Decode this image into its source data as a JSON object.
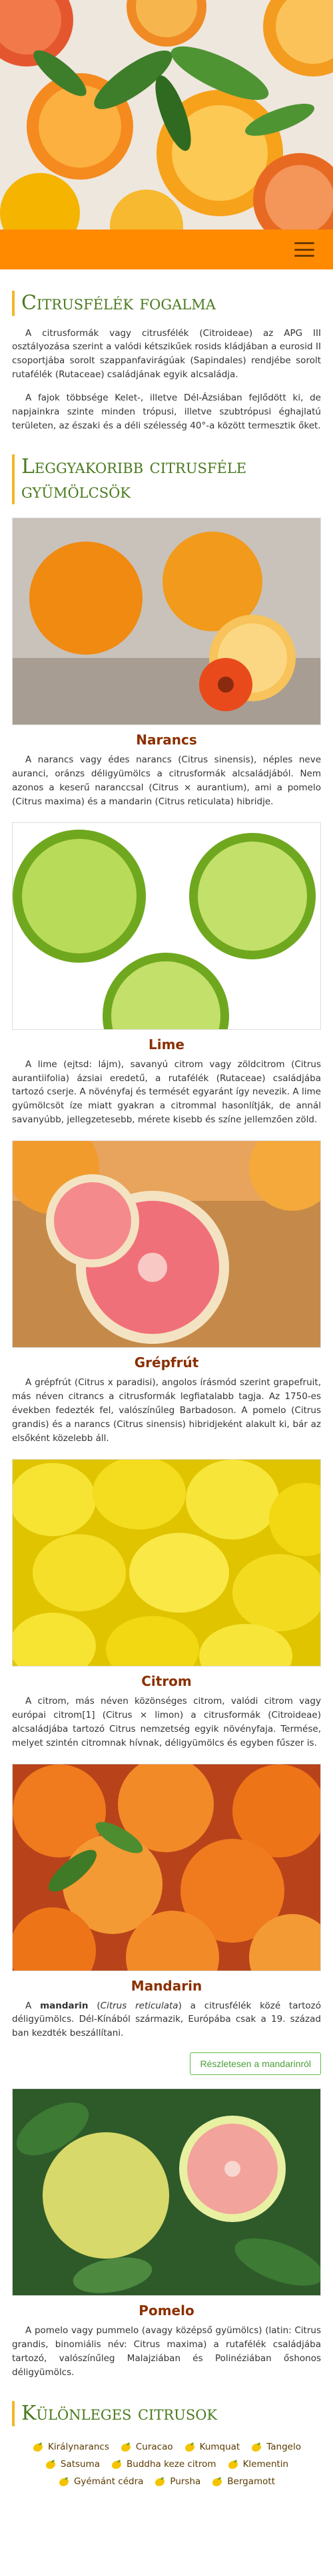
{
  "hero": {
    "image": "citrus-fruits-hero-image"
  },
  "nav": {
    "menu_icon": "hamburger-menu-icon"
  },
  "intro": {
    "title": "Citrusfélék fogalma",
    "p1": "A citrusformák vagy citrusfélék (Citroideae) az APG III osztályozása szerint a valódi kétszikűek rosids kládjában a eurosid II csoportjába sorolt szappanfavirágúak (Sapindales) rendjébe sorolt rutafélék (Rutaceae) családjának egyik alcsaládja.",
    "p2": "A fajok többsége Kelet-, illetve Dél-Ázsiában fejlődött ki, de napjainkra szinte minden trópusi, illetve szubtrópusi éghajlatú területen, az északi és a déli szélesség 40°-a között termesztik őket."
  },
  "common": {
    "title": "Leggyakoribb citrusféle gyümölcsök",
    "fruits": [
      {
        "name": "Narancs",
        "image": "oranges-photo",
        "text": "A narancs vagy édes narancs (Citrus sinensis), néples neve auranci, oránzs déligyümölcs a citrusformák alcsaládjából. Nem azonos a keserű naranccsal (Citrus × aurantium), ami a pomelo (Citrus maxima) és a mandarin (Citrus reticulata) hibridje."
      },
      {
        "name": "Lime",
        "image": "limes-photo",
        "text": "A lime (ejtsd: lájm), savanyú citrom vagy zöldcitrom (Citrus aurantiifolia) ázsiai eredetű, a rutafélék (Rutaceae) családjába tartozó cserje. A növényfaj és termését egyaránt így nevezik. A lime gyümölcsöt íze miatt gyakran a citrommal hasonlítják, de annál savanyúbb, jellegzetesebb, mérete kisebb és színe jellemzően zöld."
      },
      {
        "name": "Grépfrút",
        "image": "grapefruit-photo",
        "text": "A grépfrút (Citrus x paradisi), angolos írásmód szerint grapefruit, más néven citrancs a citrusformák legfiatalabb tagja. Az 1750-es években fedezték fel, valószínűleg Barbadoson. A pomelo (Citrus grandis) és a narancs (Citrus sinensis) hibridjeként alakult ki, bár az elsőként közelebb áll."
      },
      {
        "name": "Citrom",
        "image": "lemons-photo",
        "text": "A citrom, más néven közönséges citrom, valódi citrom vagy európai citrom[1] (Citrus × limon) a citrusformák (Citroideae) alcsaládjába tartozó Citrus nemzetség egyik növényfaja. Termése, melyet szintén citromnak hívnak, déligyümölcs és egyben fűszer is."
      },
      {
        "name": "Mandarin",
        "image": "mandarins-photo",
        "text_pre": "A ",
        "text_bold": "mandarin",
        "text_mid": " (",
        "text_italic": "Citrus reticulata",
        "text_post": ") a citrusfélék közé tartozó déligyümölcs. Dél-Kínából származik, Európába csak a 19. század ban kezdték beszállítani.",
        "more": "Részletesen a mandarinról"
      },
      {
        "name": "Pomelo",
        "image": "pomelo-photo",
        "text": "A pomelo vagy pummelo (avagy középső gyümölcs) (latin: Citrus grandis, binomiális név: Citrus maxima) a rutafélék családjába tartozó, valószínűleg Malajziában és Polinéziában őshonos déligyümölcs."
      }
    ]
  },
  "special": {
    "title": "Különleges citrusok",
    "icon": "lemon-icon",
    "items": [
      "Királynarancs",
      "Curacao",
      "Kumquat",
      "Tangelo",
      "Satsuma",
      "Buddha keze citrom",
      "Klementin",
      "Gyémánt cédra",
      "Pursha",
      "Bergamott"
    ]
  },
  "colors": {
    "accent": "#ff8a00",
    "title_green": "#4a7a1e",
    "fruit_name": "#8a3000",
    "button_green": "#5fb94a"
  }
}
